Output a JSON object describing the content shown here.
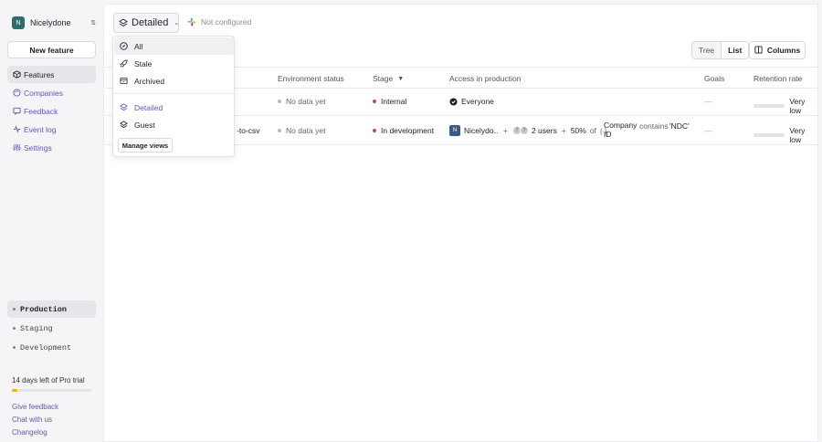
{
  "org": {
    "initial": "N",
    "name": "Nicelydone"
  },
  "sidebar": {
    "new_feature_label": "New feature",
    "nav": [
      {
        "label": "Features",
        "icon": "features-icon",
        "active": true
      },
      {
        "label": "Companies",
        "icon": "companies-icon"
      },
      {
        "label": "Feedback",
        "icon": "feedback-icon"
      },
      {
        "label": "Event log",
        "icon": "event-log-icon"
      },
      {
        "label": "Settings",
        "icon": "settings-icon"
      }
    ],
    "environments": [
      {
        "label": "Production",
        "active": true
      },
      {
        "label": "Staging"
      },
      {
        "label": "Development"
      }
    ],
    "trial_text": "14 days left of Pro trial",
    "trial_progress_fraction": 0.07,
    "footer_links": [
      "Give feedback",
      "Chat with us",
      "Changelog"
    ]
  },
  "header": {
    "view_label": "Detailed",
    "integration_status": "Not configured"
  },
  "toolbar": {
    "tree_label": "Tree",
    "list_label": "List",
    "columns_label": "Columns"
  },
  "table": {
    "columns": [
      "Environment status",
      "Stage",
      "Access in production",
      "Goals",
      "Retention rate"
    ],
    "rows": [
      {
        "name_fragment": "",
        "env_status": "No data yet",
        "stage": "Internal",
        "access": "Everyone",
        "goals": "—",
        "retention": "Very low"
      },
      {
        "name_fragment": "-to-csv",
        "env_status": "No data yet",
        "stage": "In development",
        "access_company_initial": "N",
        "access_company": "Nicelydo...",
        "access_users": "2 users",
        "access_percent": "50%",
        "access_of": "of",
        "access_attr_icon": "{·}",
        "access_attr": "Company ID",
        "access_op": "contains",
        "access_value": "'NDC'",
        "goals": "—",
        "retention": "Very low"
      }
    ]
  },
  "dropdown": {
    "filters": [
      {
        "label": "All",
        "icon": "compass-icon"
      },
      {
        "label": "Stale",
        "icon": "rocket-icon"
      },
      {
        "label": "Archived",
        "icon": "archive-icon"
      }
    ],
    "views": [
      {
        "label": "Detailed",
        "icon": "layers-icon"
      },
      {
        "label": "Guest",
        "icon": "layers-icon"
      }
    ],
    "manage_label": "Manage views"
  },
  "colors": {
    "accent": "#5a5ab8",
    "stage_dot": "#d4473d",
    "trial_fill": "#f0b400"
  }
}
